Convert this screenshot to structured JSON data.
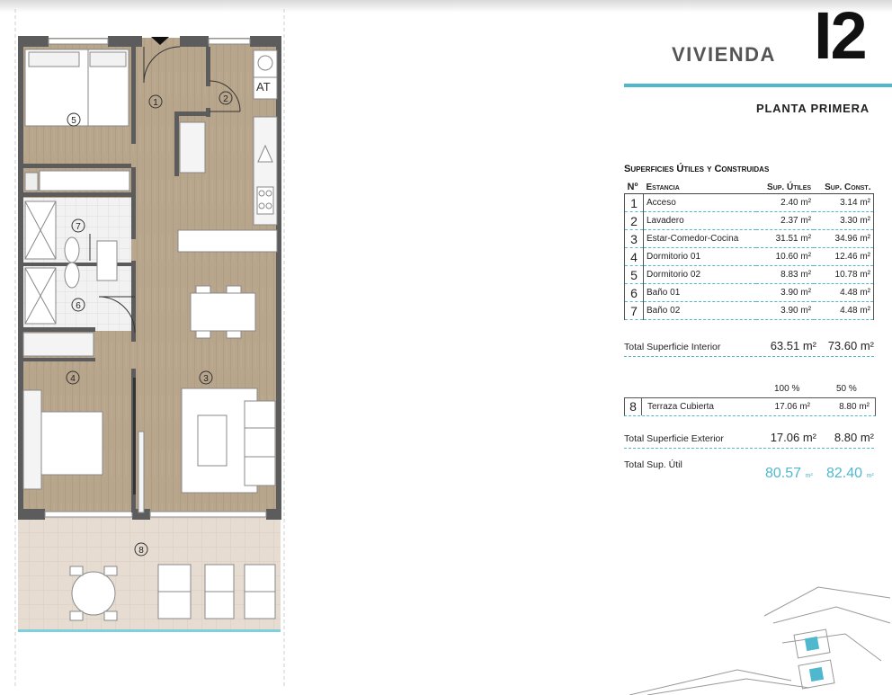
{
  "header": {
    "title": "VIVIENDA",
    "unit_code": "I2",
    "floor": "PLANTA PRIMERA",
    "accent_color": "#4fb8cf"
  },
  "plan": {
    "room_markers": [
      "1",
      "2",
      "3",
      "4",
      "5",
      "6",
      "7",
      "8"
    ],
    "appliance_label": "AT"
  },
  "table": {
    "title": "Superficies Útiles y Construidas",
    "headers": {
      "num": "Nº",
      "room": "Estancia",
      "useful": "Sup. Útiles",
      "built": "Sup. Const."
    },
    "rows": [
      {
        "n": "1",
        "name": "Acceso",
        "useful": "2.40 m²",
        "built": "3.14 m²"
      },
      {
        "n": "2",
        "name": "Lavadero",
        "useful": "2.37 m²",
        "built": "3.30 m²"
      },
      {
        "n": "3",
        "name": "Estar-Comedor-Cocina",
        "useful": "31.51 m²",
        "built": "34.96 m²"
      },
      {
        "n": "4",
        "name": "Dormitorio 01",
        "useful": "10.60 m²",
        "built": "12.46 m²"
      },
      {
        "n": "5",
        "name": "Dormitorio 02",
        "useful": "8.83 m²",
        "built": "10.78 m²"
      },
      {
        "n": "6",
        "name": "Baño 01",
        "useful": "3.90 m²",
        "built": "4.48 m²"
      },
      {
        "n": "7",
        "name": "Baño 02",
        "useful": "3.90 m²",
        "built": "4.48 m²"
      }
    ],
    "total_interior": {
      "label": "Total Superficie Interior",
      "useful": "63.51 m²",
      "built": "73.60 m²"
    },
    "exterior_headers": {
      "p1": "100 %",
      "p2": "50 %"
    },
    "terrace": {
      "n": "8",
      "name": "Terraza Cubierta",
      "v100": "17.06 m²",
      "v50": "8.80 m²"
    },
    "total_exterior": {
      "label": "Total Superficie Exterior",
      "v100": "17.06 m²",
      "v50": "8.80 m²"
    },
    "total_util": {
      "label": "Total Sup. Útil",
      "v1": "80.57",
      "v2": "82.40",
      "unit": "m²"
    }
  }
}
